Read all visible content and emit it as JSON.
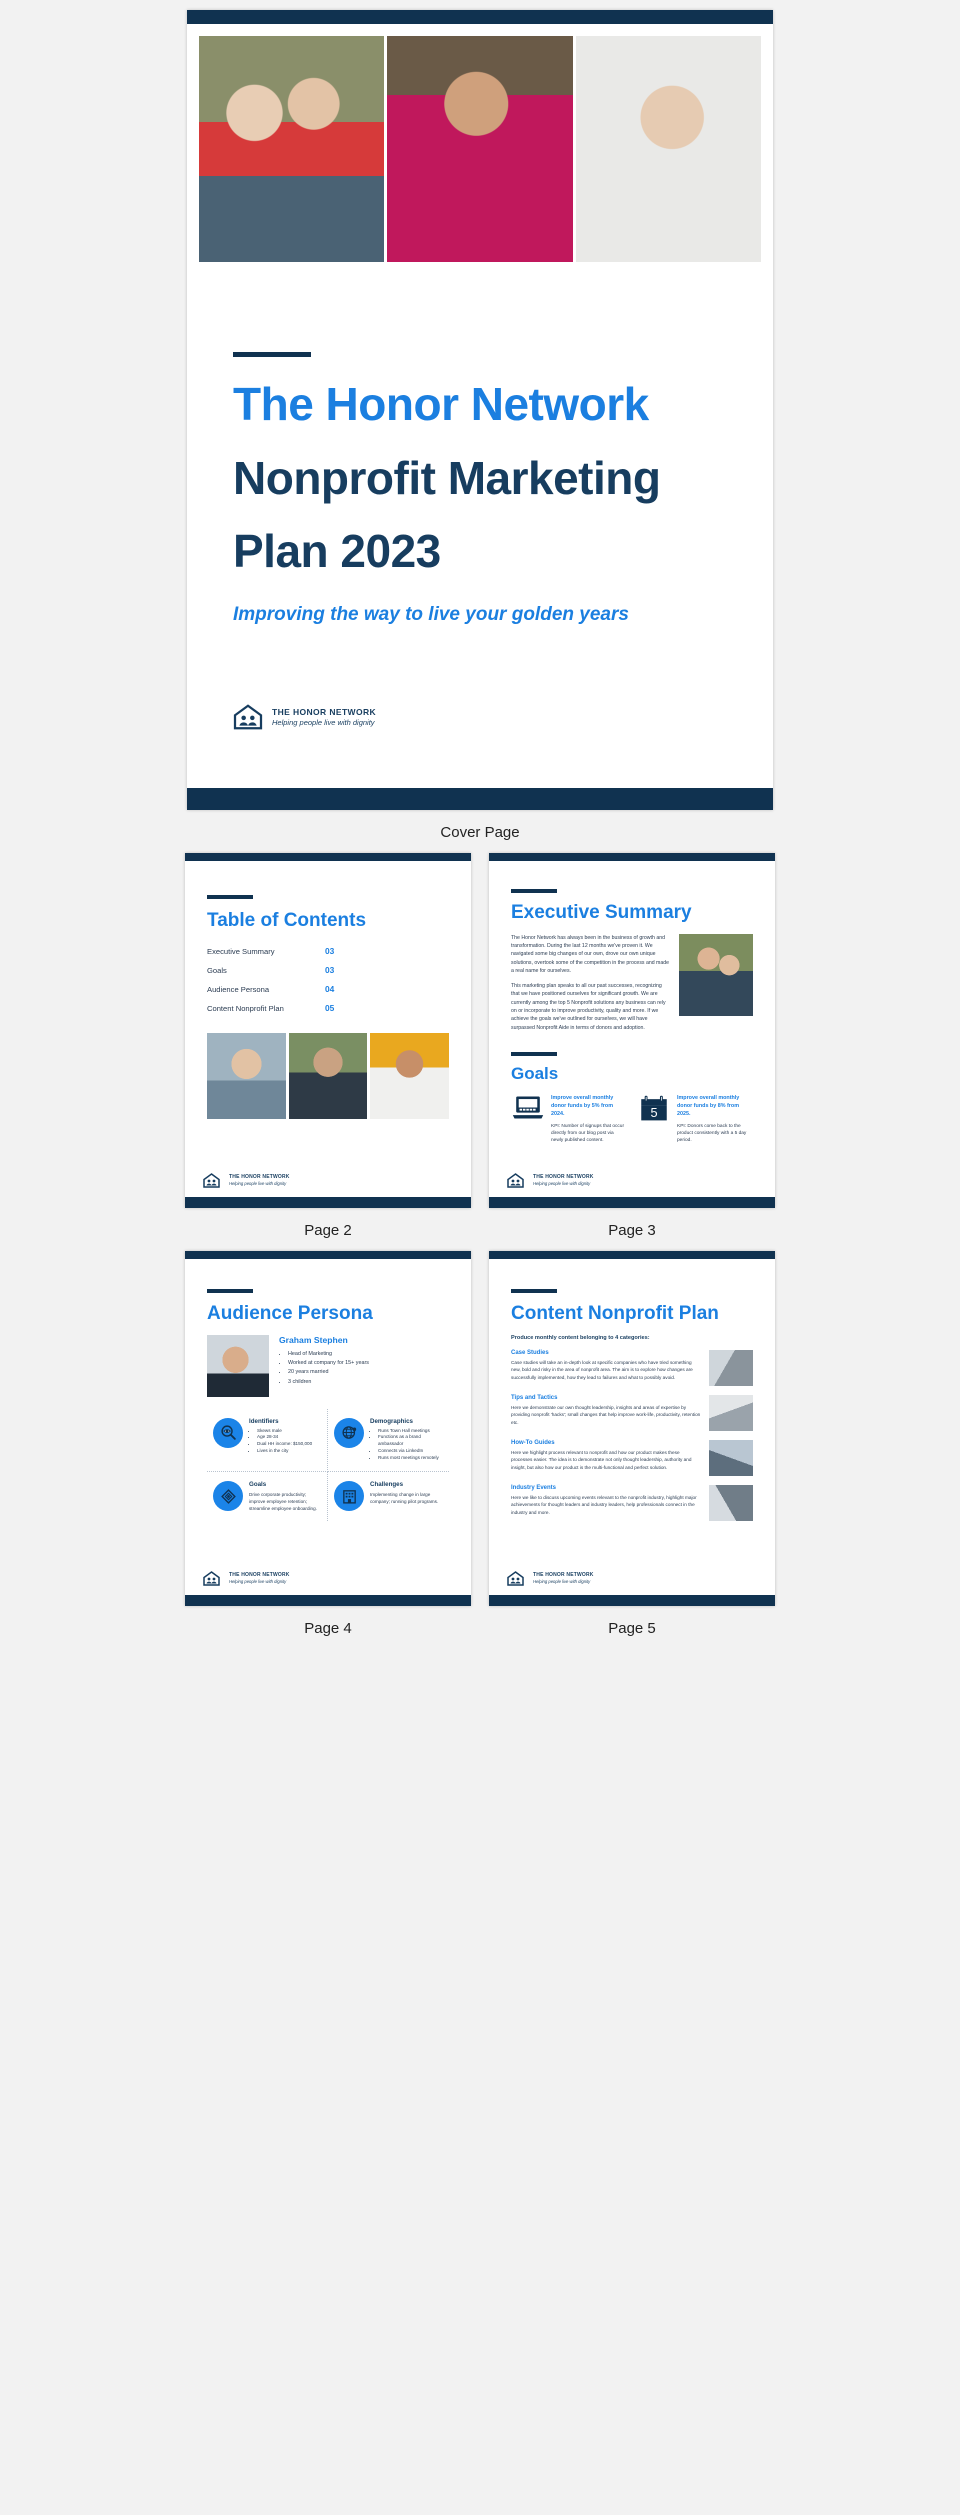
{
  "brand": {
    "accent_blue": "#1b7fe0",
    "navy": "#103250",
    "circle_blue": "#1b84e8",
    "logo_name": "THE HONOR NETWORK",
    "logo_tagline": "Helping people live with dignity"
  },
  "cover": {
    "caption": "Cover Page",
    "title_line1": "The Honor Network",
    "title_line2": "Nonprofit Marketing",
    "title_line3": "Plan 2023",
    "subtitle": "Improving the way to live your golden years",
    "photos": [
      {
        "name": "senior-couple-photo",
        "style": "p-couple"
      },
      {
        "name": "elder-man-photo",
        "style": "p-elder"
      },
      {
        "name": "senior-woman-photo",
        "style": "p-woman"
      }
    ]
  },
  "page2": {
    "caption": "Page 2",
    "title": "Table of Contents",
    "items": [
      {
        "label": "Executive Summary",
        "page": "03"
      },
      {
        "label": "Goals",
        "page": "03"
      },
      {
        "label": "Audience Persona",
        "page": "04"
      },
      {
        "label": "Content Nonprofit Plan",
        "page": "05"
      }
    ],
    "photos": [
      {
        "name": "asian-senior-photo",
        "style": "p-asian"
      },
      {
        "name": "bearded-man-photo",
        "style": "p-man"
      },
      {
        "name": "indian-woman-photo",
        "style": "p-indian"
      }
    ]
  },
  "page3": {
    "caption": "Page 3",
    "exec_title": "Executive Summary",
    "exec_p1": "The Honor Network has always been in the business of growth and transformation. During the last 12 months we've proven it. We navigated some big changes of our own, drove our own unique solutions, overtook some of the competition in the process and made a real name for ourselves.",
    "exec_p2": "This marketing plan speaks to all our past successes, recognizing that we have positioned ourselves for significant growth. We are currently among the top 5 Nonprofit solutions any business can rely on or incorporate to improve productivity, quality and more. If we achieve the goals we've outlined for ourselves, we will have surpassed Nonprofit Aide in terms of donors and adoption.",
    "goals_title": "Goals",
    "goals": [
      {
        "icon": "laptop-icon",
        "title": "Improve overall monthly donor funds by 5% from 2024.",
        "kpi": "KPI: Number of signups that occur directly from our blog post via newly published content."
      },
      {
        "icon": "calendar-icon",
        "icon_number": "5",
        "title": "Improve overall monthly donor funds by 8% from 2025.",
        "kpi": "KPI: Donors come back to the product consistently with a 5 day period."
      }
    ]
  },
  "page4": {
    "caption": "Page 4",
    "title": "Audience Persona",
    "persona_name": "Graham Stephen",
    "persona_bullets": [
      "Head of Marketing",
      "Worked at company for 15+ years",
      "20 years married",
      "3 children"
    ],
    "quadrants": [
      {
        "icon": "magnifier-eye-icon",
        "title": "Identifiers",
        "bullets": [
          "Skews male",
          "Age 28-34",
          "Dual HH income: $150,000",
          "Lives in the city"
        ]
      },
      {
        "icon": "globe-pin-icon",
        "title": "Demographics",
        "bullets": [
          "Runs Town Hall meetings",
          "Functions as a brand ambassador",
          "Connects via LinkedIn",
          "Runs most meetings remotely"
        ]
      },
      {
        "icon": "target-icon",
        "title": "Goals",
        "text": "Drive corporate productivity; improve employee retention; streamline employee onboarding."
      },
      {
        "icon": "office-building-icon",
        "title": "Challenges",
        "text": "Implementing change in large company; running pilot programs."
      }
    ]
  },
  "page5": {
    "caption": "Page 5",
    "title": "Content Nonprofit Plan",
    "lead": "Produce monthly content belonging to 4 categories:",
    "sections": [
      {
        "heading": "Case Studies",
        "text": "Case studies will take an in-depth look at specific companies who have tried something new, bold and risky in the area of nonprofit area. The aim is to explore how changes are successfully implemented, how they lead to failures and what to possibly avoid.",
        "image": "office-desk-photo",
        "style": "p-office1"
      },
      {
        "heading": "Tips and Tactics",
        "text": "Here we demonstrate our own thought leadership, insights and areas of expertise by providing nonprofit 'hacks'; small changes that help improve work-life, productivity, retention etc.",
        "image": "notebook-photo",
        "style": "p-office2"
      },
      {
        "heading": "How-To Guides",
        "text": "Here we highlight process relevant to nonprofit and how our product makes these processes easier. The idea is to demonstrate not only thought leadership, authority and insight, but also how our product is the multi-functional and perfect solution.",
        "image": "meeting-photo",
        "style": "p-office3"
      },
      {
        "heading": "Industry Events",
        "text": "Here we like to discuss upcoming events relevant to the nonprofit industry, highlight major achievements for thought leaders and industry leaders, help professionals connect in the industry and more.",
        "image": "conference-photo",
        "style": "p-office4"
      }
    ]
  }
}
